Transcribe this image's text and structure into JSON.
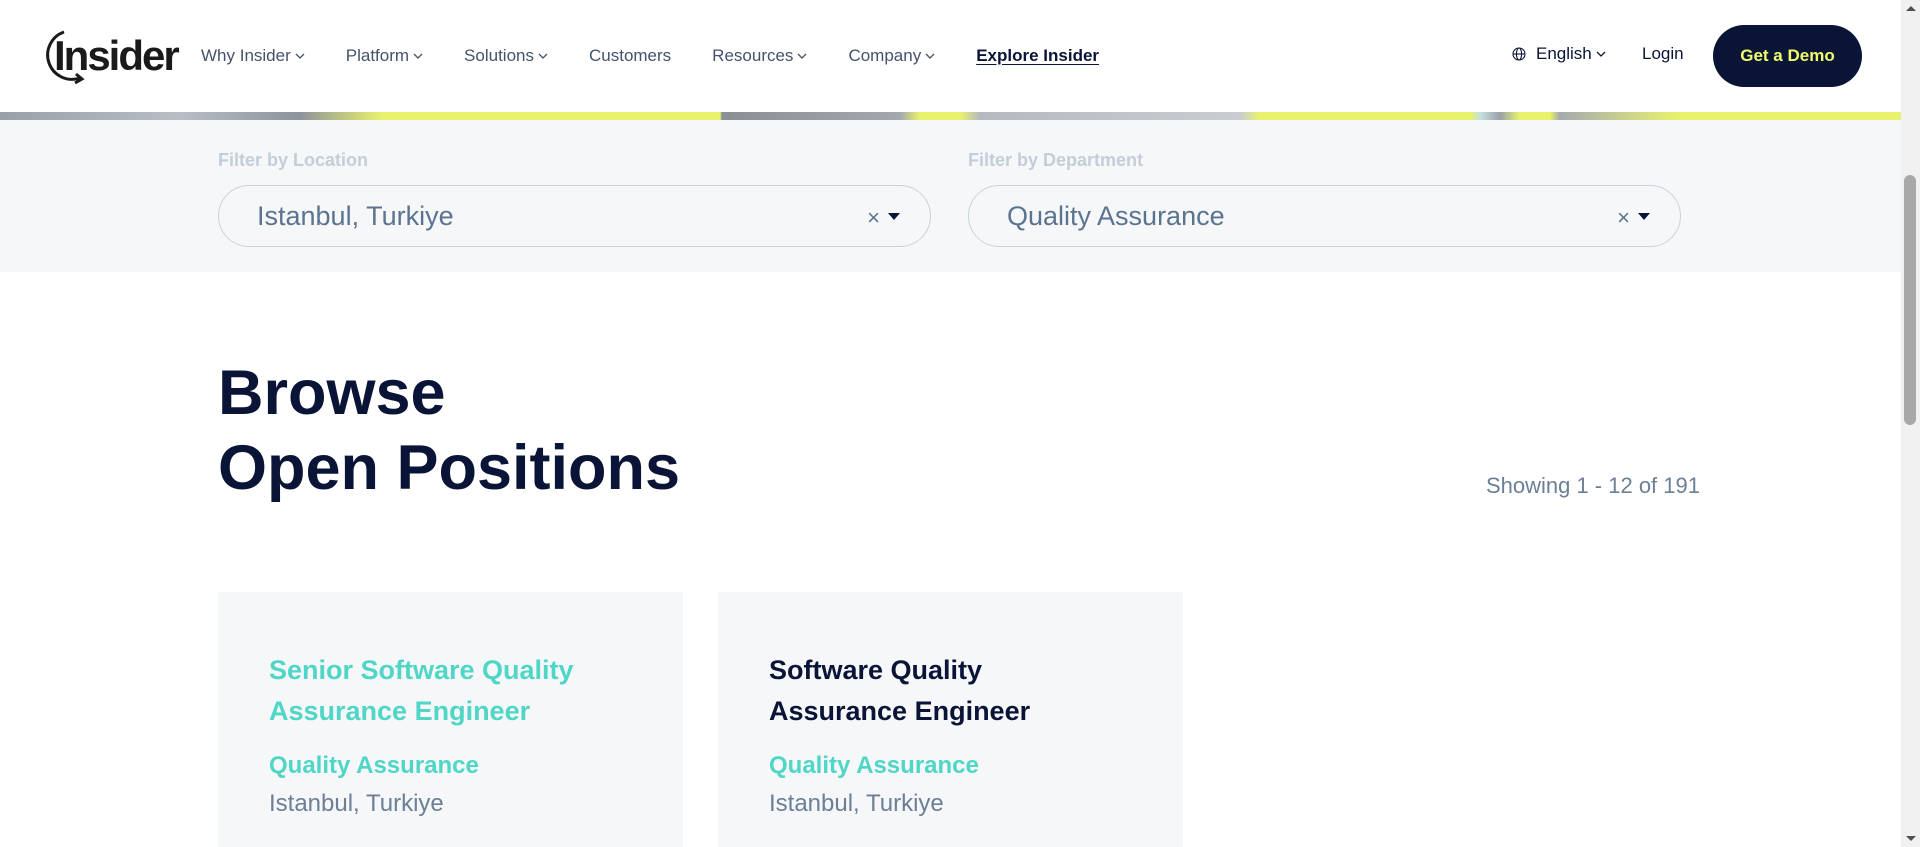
{
  "header": {
    "logo_text": "Insider",
    "nav": [
      {
        "label": "Why Insider",
        "dropdown": true
      },
      {
        "label": "Platform",
        "dropdown": true
      },
      {
        "label": "Solutions",
        "dropdown": true
      },
      {
        "label": "Customers",
        "dropdown": false
      },
      {
        "label": "Resources",
        "dropdown": true
      },
      {
        "label": "Company",
        "dropdown": true
      },
      {
        "label": "Explore Insider",
        "dropdown": false
      }
    ],
    "language": "English",
    "login": "Login",
    "demo_button": "Get a Demo"
  },
  "filters": {
    "location_label": "Filter by Location",
    "location_value": "Istanbul, Turkiye",
    "department_label": "Filter by Department",
    "department_value": "Quality Assurance",
    "clear_symbol": "×"
  },
  "browse": {
    "title_line1": "Browse",
    "title_line2": "Open Positions",
    "showing": "Showing 1 - 12 of 191"
  },
  "jobs": [
    {
      "title_line1": "Senior Software Quality",
      "title_line2": "Assurance Engineer",
      "department": "Quality Assurance",
      "location": "Istanbul, Turkiye"
    },
    {
      "title_line1": "Software Quality",
      "title_line2": "Assurance Engineer",
      "department": "Quality Assurance",
      "location": "Istanbul, Turkiye"
    }
  ],
  "colors": {
    "navy": "#0a1437",
    "teal": "#4fd6c6",
    "demo_text": "#f2fd6a",
    "band_bg": "#f5f7f9"
  }
}
